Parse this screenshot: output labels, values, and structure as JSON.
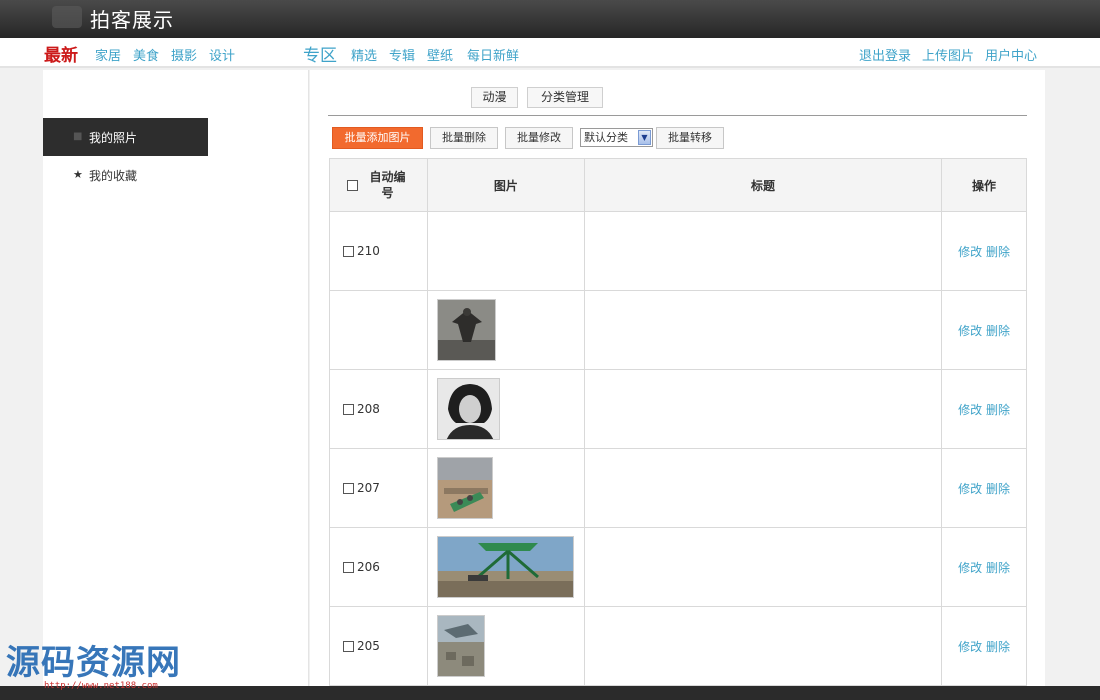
{
  "header": {
    "site_title": "拍客展示"
  },
  "nav": {
    "latest_label": "最新",
    "latest_links": [
      "家居",
      "美食",
      "摄影",
      "设计"
    ],
    "zone_label": "专区",
    "zone_links": [
      "精选",
      "专辑",
      "壁纸",
      "每日新鲜"
    ],
    "user_links": [
      "退出登录",
      "上传图片",
      "用户中心"
    ]
  },
  "sidebar": {
    "items": [
      {
        "label": "我的照片",
        "icon": "square-bullet-icon",
        "active": true
      },
      {
        "label": "我的收藏",
        "icon": "star-icon",
        "active": false
      }
    ]
  },
  "category_tabs": [
    "动漫",
    "分类管理"
  ],
  "toolbar": {
    "batch_add": "批量添加图片",
    "batch_delete": "批量删除",
    "batch_edit": "批量修改",
    "category_select": "默认分类",
    "batch_move": "批量转移"
  },
  "table": {
    "headers": {
      "id": "自动编号",
      "image": "图片",
      "title": "标题",
      "actions": "操作"
    },
    "rows": [
      {
        "id": "210",
        "image": "",
        "title": "",
        "edit": "修改",
        "delete": "删除"
      },
      {
        "id": "",
        "image": "eagle-photo",
        "title": "",
        "edit": "修改",
        "delete": "删除"
      },
      {
        "id": "208",
        "image": "portrait-photo",
        "title": "",
        "edit": "修改",
        "delete": "删除"
      },
      {
        "id": "207",
        "image": "tower-ride-photo",
        "title": "",
        "edit": "修改",
        "delete": "删除"
      },
      {
        "id": "206",
        "image": "sky-swing-photo",
        "title": "",
        "edit": "修改",
        "delete": "删除"
      },
      {
        "id": "205",
        "image": "aerial-city-photo",
        "title": "",
        "edit": "修改",
        "delete": "删除"
      }
    ]
  },
  "watermark": {
    "text": "源码资源网",
    "url": "http://www.net188.com"
  },
  "colors": {
    "accent_blue": "#3fa3c9",
    "orange_button": "#f26a2e",
    "brand_red": "#cc1a1a"
  }
}
